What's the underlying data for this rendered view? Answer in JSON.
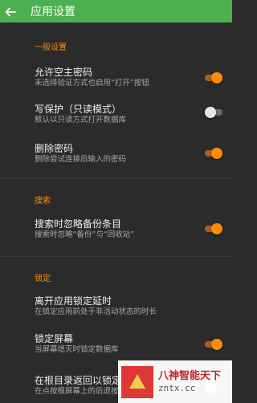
{
  "appbar": {
    "title": "应用设置",
    "back_icon": "arrow-back-icon"
  },
  "sections": [
    {
      "header": "一般设置",
      "items": [
        {
          "title": "允许空主密码",
          "summary": "未选择验证方式也启用“打开”按钮",
          "switch": "on"
        },
        {
          "title": "写保护（只读模式）",
          "summary": "默认以只读方式打开数据库",
          "switch": "off"
        },
        {
          "title": "删除密码",
          "summary": "删除尝试连接后输入的密码",
          "switch": "on"
        }
      ]
    },
    {
      "header": "搜索",
      "items": [
        {
          "title": "搜索时忽略备份条目",
          "summary": "搜索时忽略“备份”与“回收站”",
          "switch": "on"
        }
      ]
    },
    {
      "header": "锁定",
      "items": [
        {
          "title": "离开应用锁定延时",
          "summary": "在锁定应用前处于非活动状态的时长",
          "switch": null
        },
        {
          "title": "锁定屏幕",
          "summary": "当屏幕熄灭时锁定数据库",
          "switch": "on"
        },
        {
          "title": "在根目录返回以锁定",
          "summary": "在点按根屏幕上的后退按钮时锁定数据库",
          "switch": "off"
        }
      ]
    }
  ],
  "watermark": {
    "line1": "八神智能天下",
    "line2": "zntx.cc"
  },
  "colors": {
    "appbar": "#4caf50",
    "accent": "#ff8c00",
    "background": "#2b2b2b"
  }
}
